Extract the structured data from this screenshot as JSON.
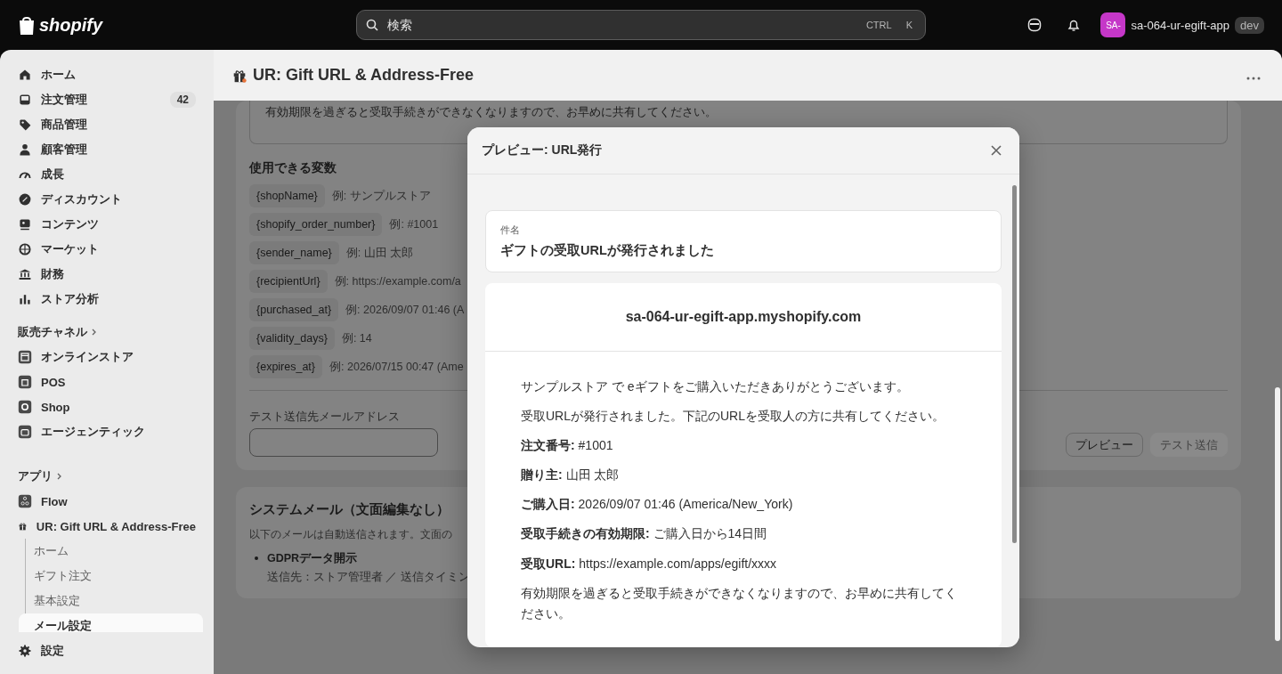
{
  "topbar": {
    "logo": "shopify",
    "search": {
      "placeholder": "検索",
      "shortcut": [
        "CTRL",
        "K"
      ]
    },
    "store": {
      "avatar": "SA-",
      "name": "sa-064-ur-egift-app",
      "badge": "dev"
    }
  },
  "sidebar": {
    "main": [
      {
        "label": "ホーム",
        "selected": false
      },
      {
        "label": "注文管理",
        "count": "42",
        "selected": false
      },
      {
        "label": "商品管理",
        "selected": false
      },
      {
        "label": "顧客管理",
        "selected": false
      },
      {
        "label": "成長",
        "selected": false
      },
      {
        "label": "ディスカウント",
        "selected": false
      },
      {
        "label": "コンテンツ",
        "selected": false
      },
      {
        "label": "マーケット",
        "selected": false
      },
      {
        "label": "財務",
        "selected": false
      },
      {
        "label": "ストア分析",
        "selected": false
      }
    ],
    "sales_channels": {
      "heading": "販売チャネル",
      "items": [
        {
          "label": "オンラインストア",
          "selected": false
        },
        {
          "label": "POS",
          "selected": false
        },
        {
          "label": "Shop",
          "selected": false
        },
        {
          "label": "エージェンティック",
          "selected": false
        }
      ]
    },
    "apps": {
      "heading": "アプリ",
      "items": [
        {
          "label": "Flow",
          "selected": false
        },
        {
          "label": "UR: Gift URL & Address-Free",
          "selected": false,
          "children": [
            {
              "label": "ホーム",
              "selected": false
            },
            {
              "label": "ギフト注文",
              "selected": false
            },
            {
              "label": "基本設定",
              "selected": false
            },
            {
              "label": "メール設定",
              "selected": true
            }
          ]
        }
      ]
    },
    "settings": "設定"
  },
  "page": {
    "title": "UR: Gift URL & Address-Free",
    "template_tail": "有効期限を過ぎると受取手続きができなくなりますので、お早めに共有してください。",
    "variables": {
      "heading": "使用できる変数",
      "items": [
        {
          "name": "{shopName}",
          "example": "例: サンプルストア"
        },
        {
          "name": "{shopify_order_number}",
          "example": "例: #1001"
        },
        {
          "name": "{sender_name}",
          "example": "例: 山田 太郎"
        },
        {
          "name": "{recipientUrl}",
          "example": "例: https://example.com/a"
        },
        {
          "name": "{purchased_at}",
          "example": "例: 2026/09/07 01:46 (A"
        },
        {
          "name": "{validity_days}",
          "example": "例: 14"
        },
        {
          "name": "{expires_at}",
          "example": "例: 2026/07/15 00:47 (Ame"
        }
      ]
    },
    "test_email": {
      "label": "テスト送信先メールアドレス"
    },
    "buttons": [
      {
        "label": "プレビュー",
        "disabled": false
      },
      {
        "label": "テスト送信",
        "disabled": true
      }
    ],
    "system_mail": {
      "title": "システムメール（文面編集なし）",
      "description": "以下のメールは自動送信されます。文面の",
      "items": [
        {
          "name": "GDPRデータ開示",
          "detail": "送信先：ストア管理者 ／ 送信タイミン"
        }
      ]
    }
  },
  "modal": {
    "title": "プレビュー: URL発行",
    "subject": {
      "label": "件名",
      "value": "ギフトの受取URLが発行されました"
    },
    "email": {
      "shop_domain": "sa-064-ur-egift-app.myshopify.com",
      "paragraphs": [
        "サンプルストア で eギフトをご購入いただきありがとうございます。",
        "受取URLが発行されました。下記のURLを受取人の方に共有してください。",
        "**注文番号:** #1001",
        "**贈り主:** 山田 太郎",
        "**ご購入日:** 2026/09/07 01:46 (America/New_York)",
        "**受取手続きの有効期限:** ご購入日から14日間",
        "**受取URL:** https://example.com/apps/egift/xxxx",
        "有効期限を過ぎると受取手続きができなくなりますので、お早めに共有してください。"
      ]
    }
  }
}
